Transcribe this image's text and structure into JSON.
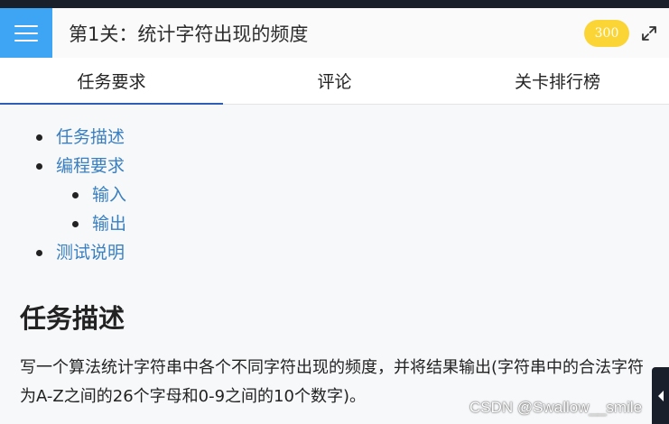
{
  "header": {
    "title": "第1关：统计字符出现的频度",
    "score": "300"
  },
  "tabs": [
    {
      "label": "任务要求",
      "active": true
    },
    {
      "label": "评论",
      "active": false
    },
    {
      "label": "关卡排行榜",
      "active": false
    }
  ],
  "toc": {
    "items": [
      {
        "label": "任务描述"
      },
      {
        "label": "编程要求"
      },
      {
        "label": "输入"
      },
      {
        "label": "输出"
      },
      {
        "label": "测试说明"
      }
    ]
  },
  "content": {
    "section_title": "任务描述",
    "description": "写一个算法统计字符串中各个不同字符出现的频度，并将结果输出(字符串中的合法字符为A-Z之间的26个字母和0-9之间的10个数字)。"
  },
  "watermark": "CSDN @Swallow__smile",
  "colors": {
    "menu_button": "#3da5f4",
    "score_badge": "#fbd535",
    "link": "#3a7fc0",
    "tab_active_underline": "#2e5db8"
  },
  "icons": {
    "menu": "hamburger-icon",
    "expand": "expand-icon",
    "side_handle": "caret-left-icon"
  }
}
